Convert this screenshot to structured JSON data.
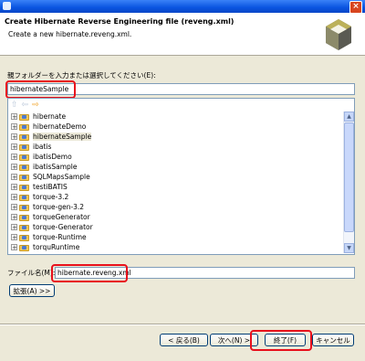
{
  "window": {
    "title": ""
  },
  "header": {
    "title": "Create Hibernate Reverse Engineering file (reveng.xml)",
    "subtitle": "Create a new hibernate.reveng.xml."
  },
  "parent_folder": {
    "label": "親フォルダーを入力または選択してください(E):",
    "value": "hibernateSample"
  },
  "tree": {
    "toolbar": [
      "back-arrow-icon",
      "forward-arrow-icon",
      "next-arrow-icon"
    ],
    "items": [
      {
        "label": "hibernate",
        "selected": false
      },
      {
        "label": "hibernateDemo",
        "selected": false
      },
      {
        "label": "hibernateSample",
        "selected": true
      },
      {
        "label": "ibatis",
        "selected": false
      },
      {
        "label": "ibatisDemo",
        "selected": false
      },
      {
        "label": "ibatisSample",
        "selected": false
      },
      {
        "label": "SQLMapsSample",
        "selected": false
      },
      {
        "label": "testiBATIS",
        "selected": false
      },
      {
        "label": "torque-3.2",
        "selected": false
      },
      {
        "label": "torque-gen-3.2",
        "selected": false
      },
      {
        "label": "torqueGenerator",
        "selected": false
      },
      {
        "label": "torque-Generator",
        "selected": false
      },
      {
        "label": "torque-Runtime",
        "selected": false
      },
      {
        "label": "torquRuntime",
        "selected": false
      }
    ]
  },
  "file_name": {
    "label": "ファイル名(M):",
    "value": "hibernate.reveng.xml"
  },
  "buttons": {
    "advanced": "拡張(A) >>",
    "back": "< 戻る(B)",
    "next": "次へ(N) >",
    "finish": "終了(F)",
    "cancel": "キャンセル"
  },
  "colors": {
    "highlight": "#e8101c",
    "titlebar": "#0a54e0"
  }
}
